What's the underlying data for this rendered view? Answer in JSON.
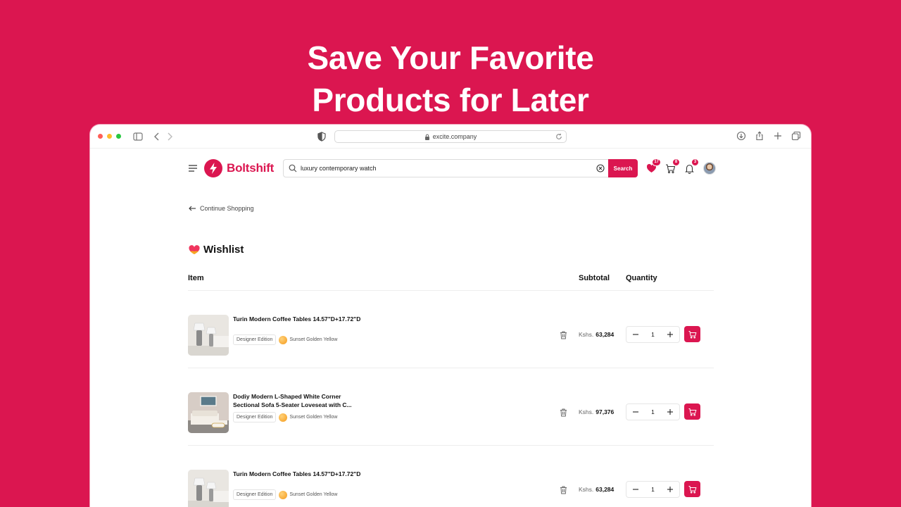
{
  "headline": {
    "line1": "Save Your Favorite",
    "line2": "Products for Later"
  },
  "browser": {
    "url": "excite.company"
  },
  "header": {
    "brand": "Boltshift",
    "search_value": "luxury contemporary watch",
    "search_button": "Search",
    "wishlist_count": "17",
    "cart_count": "8",
    "notifications_count": "3"
  },
  "nav": {
    "continue_label": "Continue Shopping"
  },
  "page": {
    "title": "Wishlist"
  },
  "table": {
    "col_item": "Item",
    "col_subtotal": "Subtotal",
    "col_quantity": "Quantity"
  },
  "items": [
    {
      "name": "Turin Modern Coffee Tables 14.57\"D+17.72\"D",
      "edition": "Designer Edition",
      "color": "Sunset Golden Yellow",
      "currency": "Kshs.",
      "price": "63,284",
      "qty": "1"
    },
    {
      "name": "Dodiy Modern L-Shaped White Corner Sectional Sofa 5-Seater Loveseat with C...",
      "edition": "Designer Edition",
      "color": "Sunset Golden Yellow",
      "currency": "Kshs.",
      "price": "97,376",
      "qty": "1"
    },
    {
      "name": "Turin Modern Coffee Tables 14.57\"D+17.72\"D",
      "edition": "Designer Edition",
      "color": "Sunset Golden Yellow",
      "currency": "Kshs.",
      "price": "63,284",
      "qty": "1"
    }
  ],
  "colors": {
    "brand": "#DB1650",
    "swatch": "#F59A1B"
  }
}
